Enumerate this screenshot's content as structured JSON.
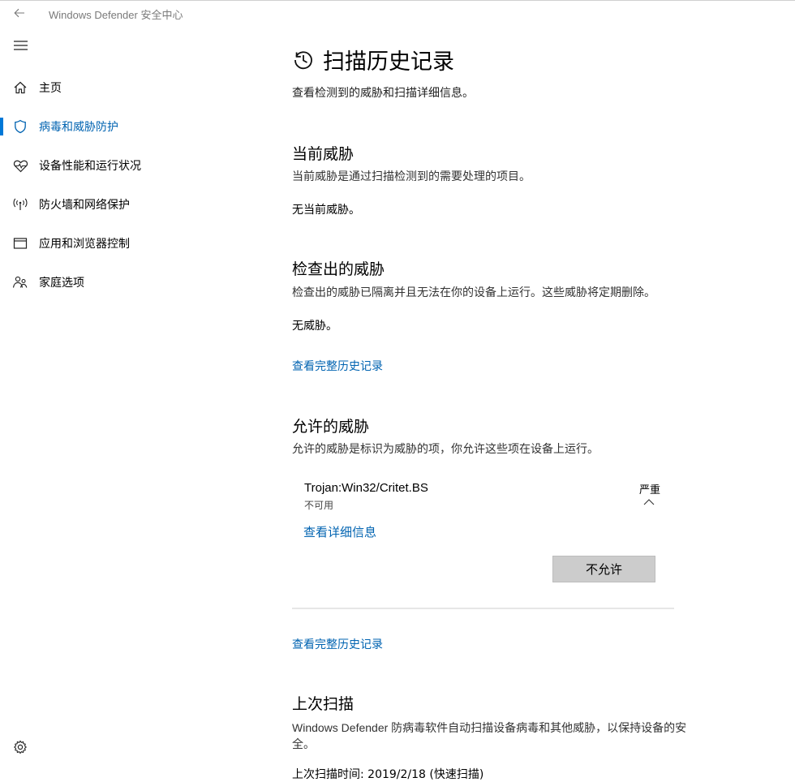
{
  "window": {
    "title": "Windows Defender 安全中心"
  },
  "nav": {
    "items": [
      {
        "label": "主页",
        "icon": "home-icon"
      },
      {
        "label": "病毒和威胁防护",
        "icon": "shield-icon",
        "active": true
      },
      {
        "label": "设备性能和运行状况",
        "icon": "heart-icon"
      },
      {
        "label": "防火墙和网络保护",
        "icon": "wifi-icon"
      },
      {
        "label": "应用和浏览器控制",
        "icon": "window-icon"
      },
      {
        "label": "家庭选项",
        "icon": "family-icon"
      }
    ],
    "settings_icon": "gear-icon"
  },
  "page": {
    "title": "扫描历史记录",
    "subtitle": "查看检测到的威胁和扫描详细信息。"
  },
  "current_threats": {
    "title": "当前威胁",
    "desc": "当前威胁是通过扫描检测到的需要处理的项目。",
    "status": "无当前威胁。"
  },
  "quarantined": {
    "title": "检查出的威胁",
    "desc": "检查出的威胁已隔离并且无法在你的设备上运行。这些威胁将定期删除。",
    "status": "无威胁。",
    "link": "查看完整历史记录"
  },
  "allowed": {
    "title": "允许的威胁",
    "desc": "允许的威胁是标识为威胁的项，你允许这些项在设备上运行。",
    "threat": {
      "name": "Trojan:Win32/Critet.BS",
      "status": "不可用",
      "severity": "严重",
      "details_link": "查看详细信息",
      "button": "不允许"
    },
    "link": "查看完整历史记录"
  },
  "last_scan": {
    "title": "上次扫描",
    "desc": "Windows Defender 防病毒软件自动扫描设备病毒和其他威胁，以保持设备的安全。",
    "partial_line": "上次扫描时间: 2019/2/18 (快速扫描)"
  },
  "colors": {
    "accent": "#0078d7",
    "link": "#0063b1",
    "button": "#cccccc"
  }
}
